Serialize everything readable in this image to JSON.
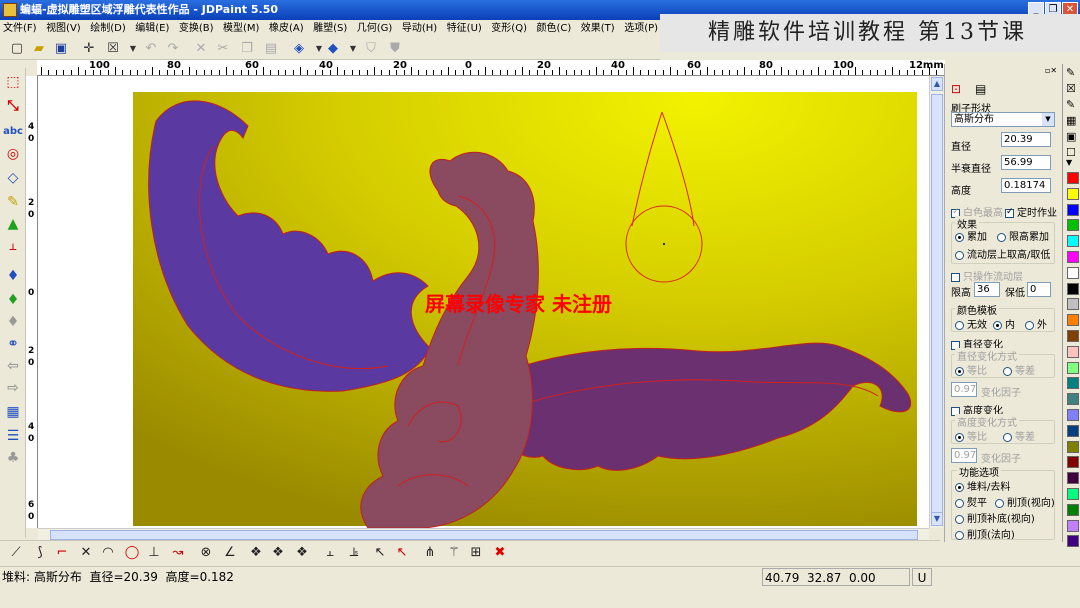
{
  "window": {
    "title": "蝙蝠-虚拟雕塑区域浮雕代表性作品 - JDPaint 5.50",
    "buttons": [
      "_",
      "❐",
      "✕"
    ]
  },
  "banner": {
    "text": "精雕软件培训教程  第13节课"
  },
  "menu": [
    "文件(F)",
    "视图(V)",
    "绘制(D)",
    "编辑(E)",
    "变换(B)",
    "模型(M)",
    "橡皮(A)",
    "雕塑(S)",
    "几何(G)",
    "导动(H)",
    "特征(U)",
    "变形(Q)",
    "颜色(C)",
    "效果(T)",
    "选项(P)",
    "艺"
  ],
  "ruler": {
    "h_labels": [
      "100",
      "80",
      "60",
      "40",
      "20",
      "0",
      "20",
      "40",
      "60",
      "80",
      "100",
      "12mm"
    ],
    "v_labels": [
      "4",
      "0",
      "2",
      "0",
      "0",
      "2",
      "0",
      "4",
      "0",
      "6",
      "0"
    ]
  },
  "watermark": "屏幕录像专家 未注册",
  "panel": {
    "brush_shape_label": "刷子形状",
    "brush_shape_value": "高斯分布",
    "diameter_label": "直径",
    "diameter_value": "20.39",
    "half_diameter_label": "半衰直径",
    "half_diameter_value": "56.99",
    "height_label": "高度",
    "height_value": "0.18174",
    "white_highest_label": "白色最高",
    "timed_label": "定时作业",
    "effect_label": "效果",
    "effect_add": "累加",
    "effect_limit": "限高累加",
    "effect_flow": "流动层上取高/取低",
    "only_flow_label": "只操作流动层",
    "limit_high_label": "限高",
    "limit_high_value": "36",
    "keep_low_label": "保低",
    "keep_low_value": "0",
    "color_template_label": "颜色模板",
    "ct_none": "无效",
    "ct_in": "内",
    "ct_out": "外",
    "diam_change_label": "直径变化",
    "diam_mode_label": "直径变化方式",
    "ratio": "等比",
    "diff": "等差",
    "factor_value": "0.97",
    "factor_label": "变化因子",
    "height_change_label": "高度变化",
    "height_mode_label": "高度变化方式",
    "func_label": "功能选项",
    "func_pile": "堆料/去料",
    "func_flat": "熨平",
    "func_cut_view": "削顶(视向)",
    "func_fill": "削顶补底(视向)",
    "func_cut_normal": "削顶(法向)"
  },
  "palette": [
    "#ff0000",
    "#ffff00",
    "#0000ff",
    "#00c000",
    "#00ffff",
    "#ff00ff",
    "#ffffff",
    "#000000",
    "#c0c0c0",
    "#ff8000",
    "#804000",
    "#ffc0c0",
    "#80ff80",
    "#008080",
    "#408080",
    "#8080ff",
    "#004080",
    "#808000",
    "#800000",
    "#400040",
    "#00ff80",
    "#008000",
    "#c080ff",
    "#400080"
  ],
  "status": {
    "left": "堆料: 高斯分布  直径=20.39  高度=0.182",
    "coords": "40.79  32.87  0.00",
    "mode": "U"
  }
}
